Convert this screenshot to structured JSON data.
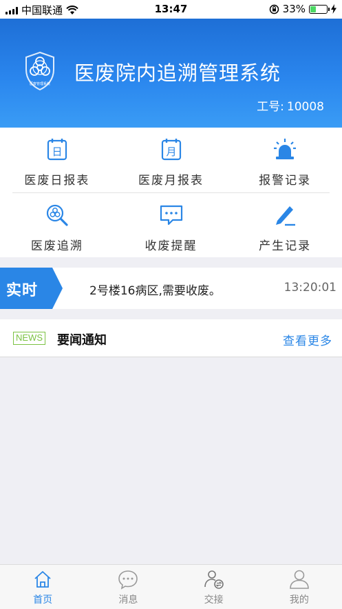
{
  "status_bar": {
    "carrier": "中国联通",
    "time": "13:47",
    "battery": "33%",
    "battery_level": 0.33
  },
  "header": {
    "title": "医废院内追溯管理系统",
    "employee_label": "工号:",
    "employee_id": "10008",
    "logo_icon": "biohazard-shield-icon",
    "logo_text": "医废管理系统"
  },
  "menu": [
    {
      "label": "医废日报表",
      "icon": "calendar-day-icon",
      "glyph": "日"
    },
    {
      "label": "医废月报表",
      "icon": "calendar-month-icon",
      "glyph": "月"
    },
    {
      "label": "报警记录",
      "icon": "alarm-light-icon"
    },
    {
      "label": "医废追溯",
      "icon": "biohazard-search-icon"
    },
    {
      "label": "收废提醒",
      "icon": "chat-reminder-icon"
    },
    {
      "label": "产生记录",
      "icon": "edit-pen-icon"
    }
  ],
  "realtime": {
    "tag": "实时",
    "message": "2号楼16病区,需要收废。",
    "time": "13:20:01"
  },
  "news": {
    "badge": "NEWS",
    "title": "要闻通知",
    "more": "查看更多"
  },
  "tabs": [
    {
      "label": "首页",
      "icon": "home-icon",
      "active": true
    },
    {
      "label": "消息",
      "icon": "message-icon",
      "active": false
    },
    {
      "label": "交接",
      "icon": "handover-icon",
      "active": false
    },
    {
      "label": "我的",
      "icon": "user-icon",
      "active": false
    }
  ],
  "colors": {
    "primary": "#2a86e6",
    "header_top": "#1e6fd6",
    "news_green": "#7bc242",
    "battery_green": "#4cd964"
  }
}
